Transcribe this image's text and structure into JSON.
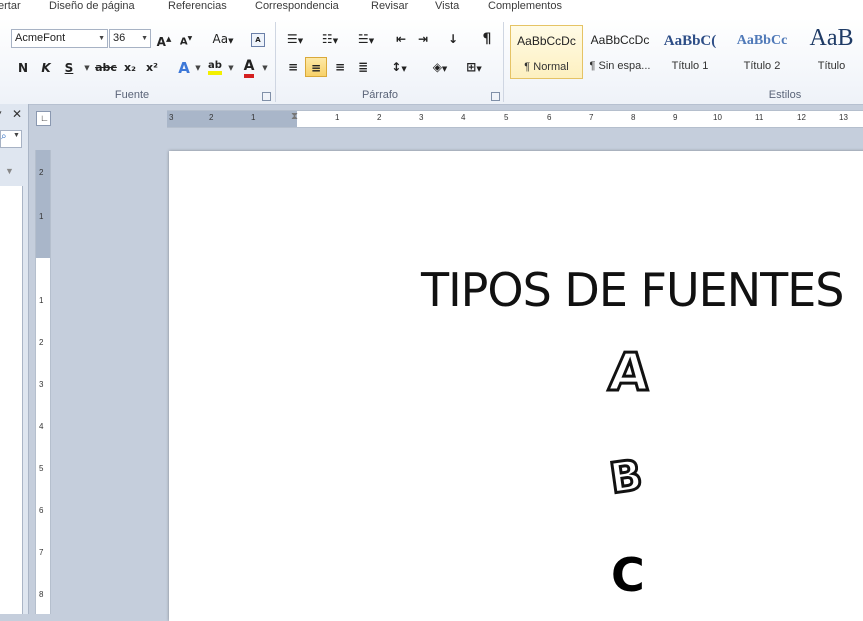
{
  "menu": {
    "tabs": [
      "ertar",
      "Diseño de página",
      "Referencias",
      "Correspondencia",
      "Revisar",
      "Vista",
      "Complementos"
    ]
  },
  "font_group": {
    "font_name": "AcmeFont",
    "font_size": "36",
    "label": "Fuente",
    "grow_label": "A",
    "shrink_label": "A",
    "case_label": "Aa",
    "bold": "N",
    "italic": "K",
    "underline": "S",
    "strike": "abc",
    "subscript": "x₂",
    "superscript": "x²",
    "effects_letter": "A",
    "highlight_letter": "ab",
    "font_color_letter": "A"
  },
  "paragraph_group": {
    "label": "Párrafo",
    "show_marks": "¶"
  },
  "styles_group": {
    "label": "Estilos",
    "items": [
      {
        "preview": "AaBbCcDc",
        "name": "¶ Normal"
      },
      {
        "preview": "AaBbCcDc",
        "name": "¶ Sin espa..."
      },
      {
        "preview": "AaBbC(",
        "name": "Título 1"
      },
      {
        "preview": "AaBbCc",
        "name": "Título 2"
      },
      {
        "preview": "AaB",
        "name": "Título"
      }
    ]
  },
  "ruler": {
    "h_numbers": [
      "3",
      "2",
      "1",
      "1",
      "2",
      "3",
      "4",
      "5",
      "6",
      "7",
      "8",
      "9",
      "10",
      "11",
      "12",
      "13"
    ],
    "v_numbers": [
      "2",
      "1",
      "1",
      "2",
      "3",
      "4",
      "5",
      "6",
      "7",
      "8"
    ]
  },
  "document": {
    "title": "TIPOS DE FUENTES",
    "letters": [
      "A",
      "B",
      "C"
    ]
  },
  "colors": {
    "accent": "#f8d168",
    "font_color_red": "#d42020",
    "highlight_yellow": "#f3f000"
  }
}
